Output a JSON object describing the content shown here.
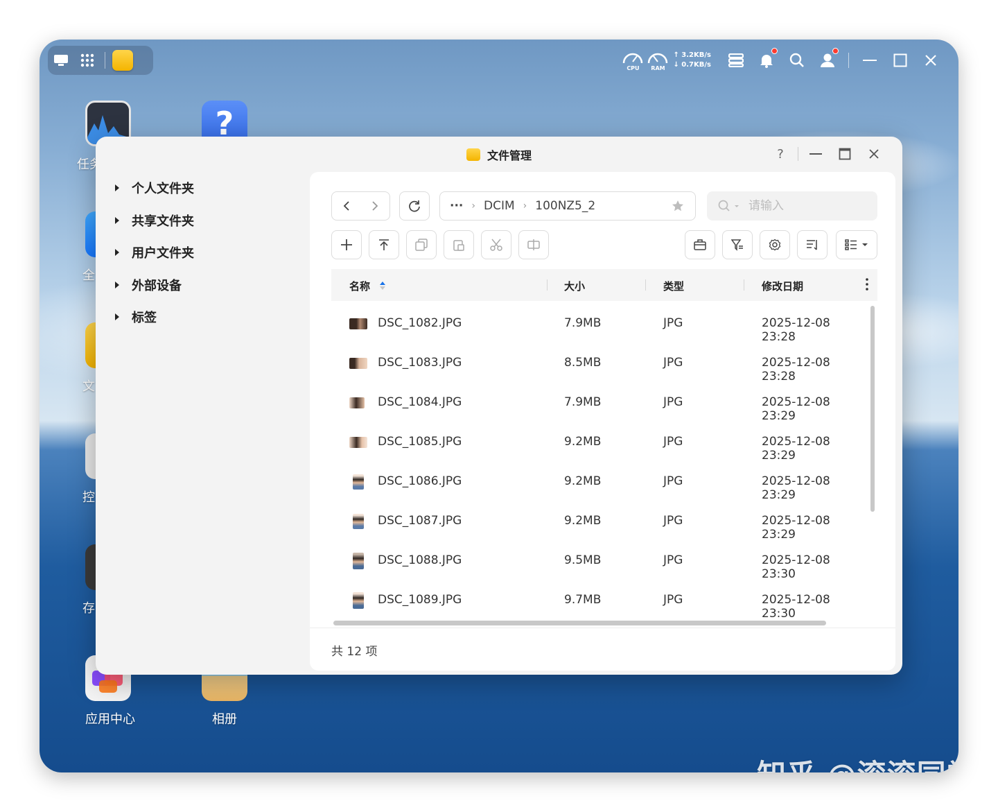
{
  "topbar": {
    "cpu_label": "CPU",
    "ram_label": "RAM",
    "upload_speed": "↑ 3.2KB/s",
    "download_speed": "↓ 0.7KB/s"
  },
  "desktop_icons": [
    {
      "label": "任务",
      "icon": "activity-monitor-icon"
    },
    {
      "label": "全",
      "icon": "all-apps-icon"
    },
    {
      "label": "文",
      "icon": "file-manager-icon"
    },
    {
      "label": "控",
      "icon": "control-panel-icon"
    },
    {
      "label": "存",
      "icon": "storage-icon"
    },
    {
      "label": "应用中心",
      "icon": "app-center-icon"
    },
    {
      "label": "相册",
      "icon": "photos-icon"
    },
    {
      "label": "?",
      "icon": "help-icon"
    }
  ],
  "window": {
    "title": "文件管理",
    "help": "?"
  },
  "sidebar": {
    "items": [
      {
        "label": "个人文件夹"
      },
      {
        "label": "共享文件夹"
      },
      {
        "label": "用户文件夹"
      },
      {
        "label": "外部设备"
      },
      {
        "label": "标签"
      }
    ]
  },
  "path": {
    "more": "···",
    "segments": [
      "DCIM",
      "100NZ5_2"
    ]
  },
  "search": {
    "placeholder": "请输入"
  },
  "table": {
    "columns": {
      "name": "名称",
      "size": "大小",
      "type": "类型",
      "date": "修改日期"
    },
    "rows": [
      {
        "name": "DSC_1082.JPG",
        "size": "7.9MB",
        "type": "JPG",
        "date": "2025-12-08 23:28"
      },
      {
        "name": "DSC_1083.JPG",
        "size": "8.5MB",
        "type": "JPG",
        "date": "2025-12-08 23:28"
      },
      {
        "name": "DSC_1084.JPG",
        "size": "7.9MB",
        "type": "JPG",
        "date": "2025-12-08 23:29"
      },
      {
        "name": "DSC_1085.JPG",
        "size": "9.2MB",
        "type": "JPG",
        "date": "2025-12-08 23:29"
      },
      {
        "name": "DSC_1086.JPG",
        "size": "9.2MB",
        "type": "JPG",
        "date": "2025-12-08 23:29"
      },
      {
        "name": "DSC_1087.JPG",
        "size": "9.2MB",
        "type": "JPG",
        "date": "2025-12-08 23:29"
      },
      {
        "name": "DSC_1088.JPG",
        "size": "9.5MB",
        "type": "JPG",
        "date": "2025-12-08 23:30"
      },
      {
        "name": "DSC_1089.JPG",
        "size": "9.7MB",
        "type": "JPG",
        "date": "2025-12-08 23:30"
      }
    ]
  },
  "footer": {
    "count": "共 12 项"
  },
  "watermark": "知乎 @滚滚同学",
  "colors": {
    "accent": "#1a73e8",
    "folder": "#f4b400"
  }
}
